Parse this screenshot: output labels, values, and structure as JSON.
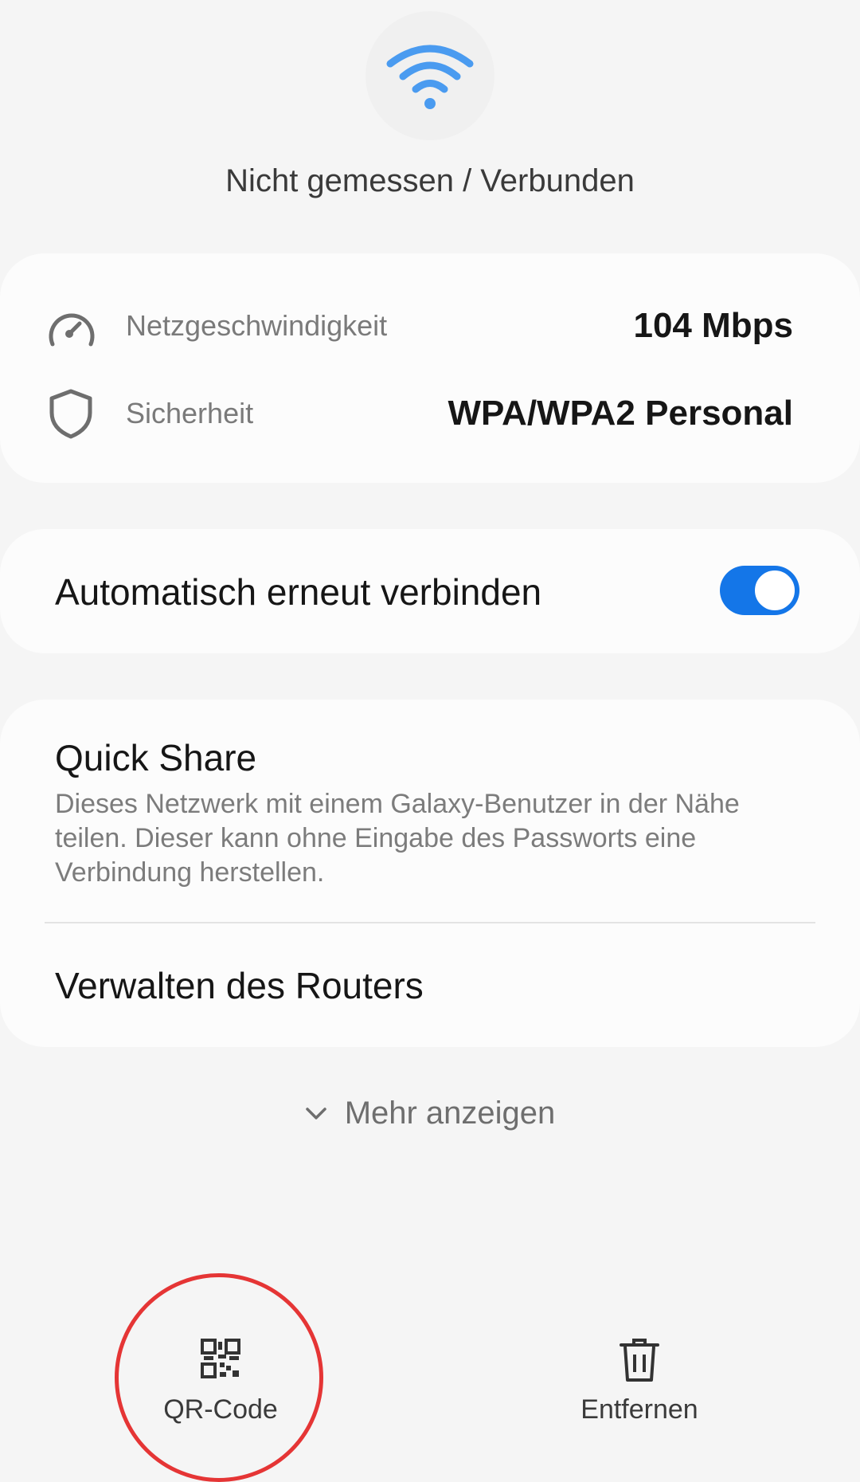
{
  "header": {
    "wifi_icon": "wifi-icon",
    "status": "Nicht gemessen / Verbunden"
  },
  "info_card": {
    "speed": {
      "icon": "speedometer-icon",
      "label": "Netzgeschwindigkeit",
      "value": "104 Mbps"
    },
    "security": {
      "icon": "shield-icon",
      "label": "Sicherheit",
      "value": "WPA/WPA2 Personal"
    }
  },
  "auto_reconnect": {
    "label": "Automatisch erneut verbinden",
    "enabled": true
  },
  "quick_share": {
    "title": "Quick Share",
    "description": "Dieses Netzwerk mit einem Galaxy-Benutzer in der Nähe teilen. Dieser kann ohne Eingabe des Passworts eine Verbindung herstellen."
  },
  "manage_router": {
    "label": "Verwalten des Routers"
  },
  "show_more": {
    "icon": "chevron-down-icon",
    "label": "Mehr anzeigen"
  },
  "bottom_bar": {
    "qr": {
      "icon": "qr-code-icon",
      "label": "QR-Code"
    },
    "remove": {
      "icon": "trash-icon",
      "label": "Entfernen"
    }
  },
  "colors": {
    "accent": "#1476e8",
    "wifi": "#4a9bf0",
    "highlight_circle": "#e53535"
  }
}
